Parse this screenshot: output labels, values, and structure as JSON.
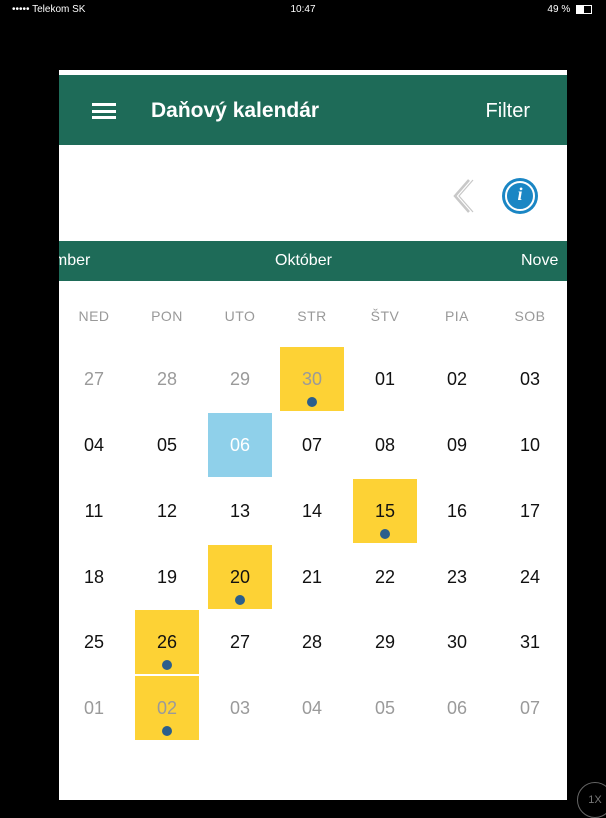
{
  "status_bar": {
    "carrier": "••••• Telekom SK",
    "time": "10:47",
    "battery": "49 %"
  },
  "header": {
    "title": "Daňový kalendár",
    "filter_label": "Filter"
  },
  "months": {
    "prev": "ember",
    "current": "Október",
    "next": "Nove"
  },
  "weekdays": [
    "NED",
    "PON",
    "UTO",
    "STR",
    "ŠTV",
    "PIA",
    "SOB"
  ],
  "calendar": {
    "weeks": [
      [
        "27",
        "28",
        "29",
        "30",
        "01",
        "02",
        "03"
      ],
      [
        "04",
        "05",
        "06",
        "07",
        "08",
        "09",
        "10"
      ],
      [
        "11",
        "12",
        "13",
        "14",
        "15",
        "16",
        "17"
      ],
      [
        "18",
        "19",
        "20",
        "21",
        "22",
        "23",
        "24"
      ],
      [
        "25",
        "26",
        "27",
        "28",
        "29",
        "30",
        "31"
      ],
      [
        "01",
        "02",
        "03",
        "04",
        "05",
        "06",
        "07"
      ]
    ]
  },
  "colors": {
    "header_green": "#1e6b58",
    "highlight_yellow": "#fdd235",
    "today_blue": "#8fd0ea",
    "event_dot": "#2b5e8c",
    "info_blue": "#1a86c4"
  },
  "zoom_badge": "1X"
}
